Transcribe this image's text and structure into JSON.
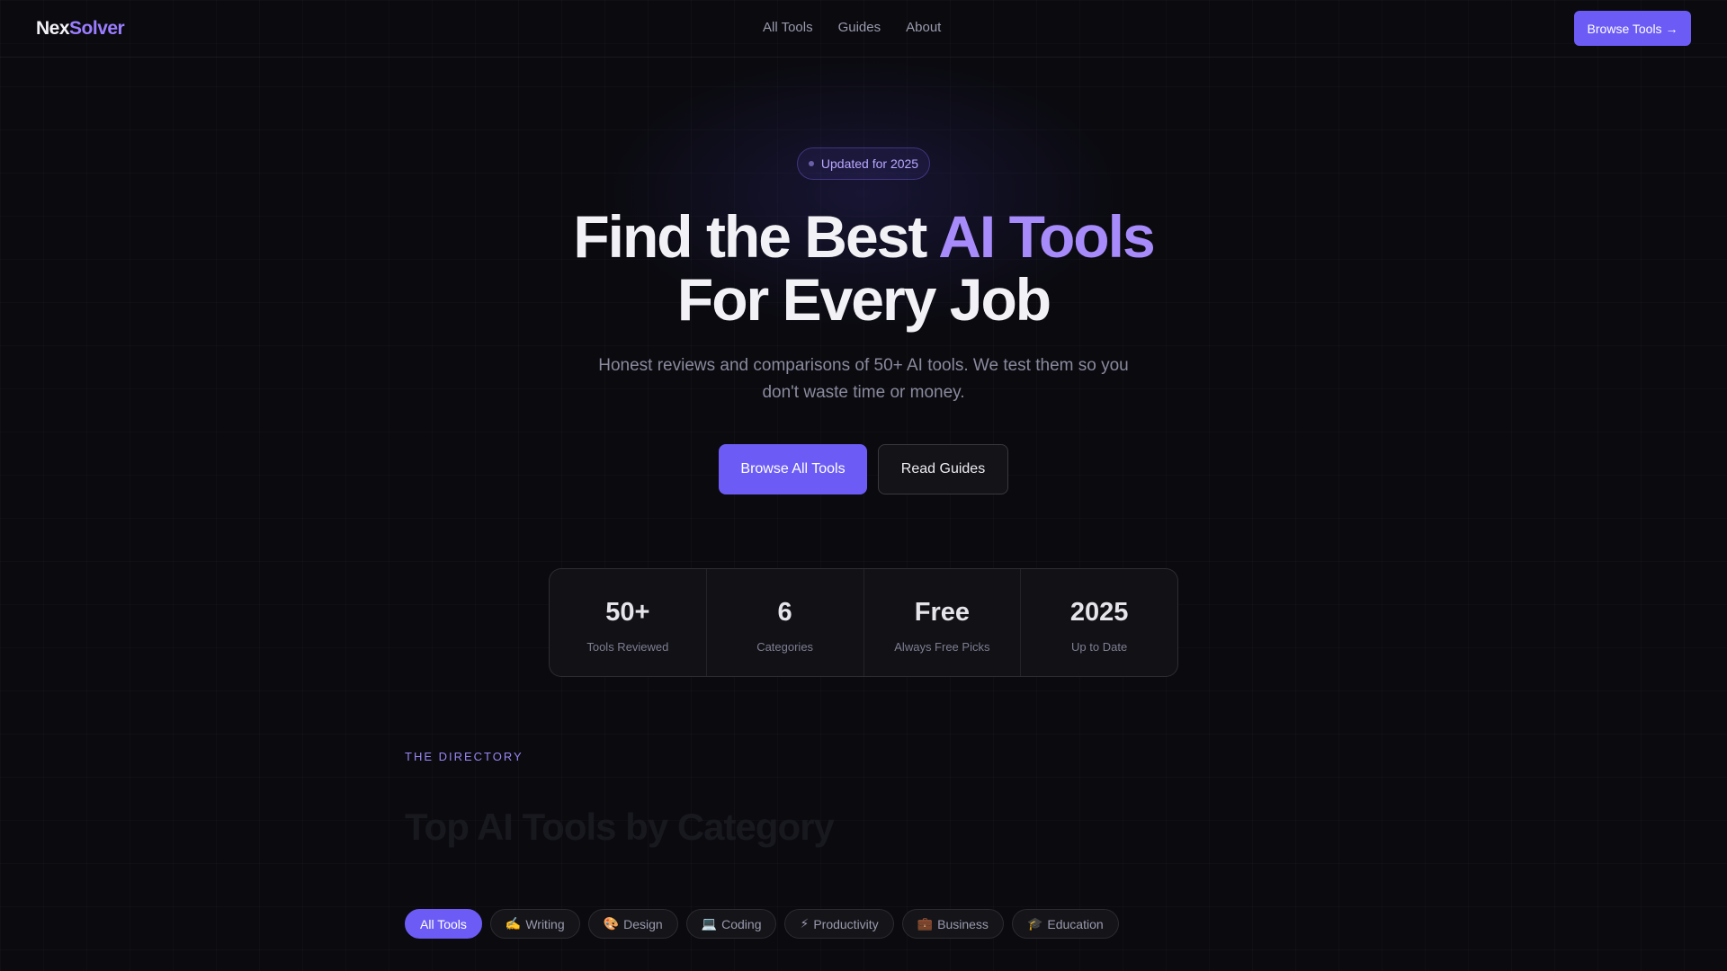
{
  "nav": {
    "logo_a": "Nex",
    "logo_b": "Solver",
    "links": [
      "All Tools",
      "Guides",
      "About"
    ],
    "cta": "Browse Tools →"
  },
  "hero": {
    "badge": "Updated for 2025",
    "headline_a": "Find the Best ",
    "headline_accent": "AI Tools",
    "headline_b": "For Every Job",
    "subtitle": "Honest reviews and comparisons of 50+ AI tools. We test them so you don't waste time or money.",
    "primary_button": "Browse All Tools",
    "secondary_button": "Read Guides"
  },
  "stats": [
    {
      "value": "50+",
      "label": "Tools Reviewed"
    },
    {
      "value": "6",
      "label": "Categories"
    },
    {
      "value": "Free",
      "label": "Always Free Picks"
    },
    {
      "value": "2025",
      "label": "Up to Date"
    }
  ],
  "directory": {
    "eyebrow": "THE DIRECTORY",
    "title": "Top AI Tools by Category",
    "filters": [
      {
        "icon": "",
        "label": "All Tools",
        "active": true
      },
      {
        "icon": "✍️",
        "label": "Writing",
        "active": false
      },
      {
        "icon": "🎨",
        "label": "Design",
        "active": false
      },
      {
        "icon": "💻",
        "label": "Coding",
        "active": false
      },
      {
        "icon": "⚡",
        "label": "Productivity",
        "active": false
      },
      {
        "icon": "💼",
        "label": "Business",
        "active": false
      },
      {
        "icon": "🎓",
        "label": "Education",
        "active": false
      }
    ]
  },
  "colors": {
    "background": "#0a0a0f",
    "accent": "#6c5cf5",
    "accent_text": "#a78bfa"
  }
}
